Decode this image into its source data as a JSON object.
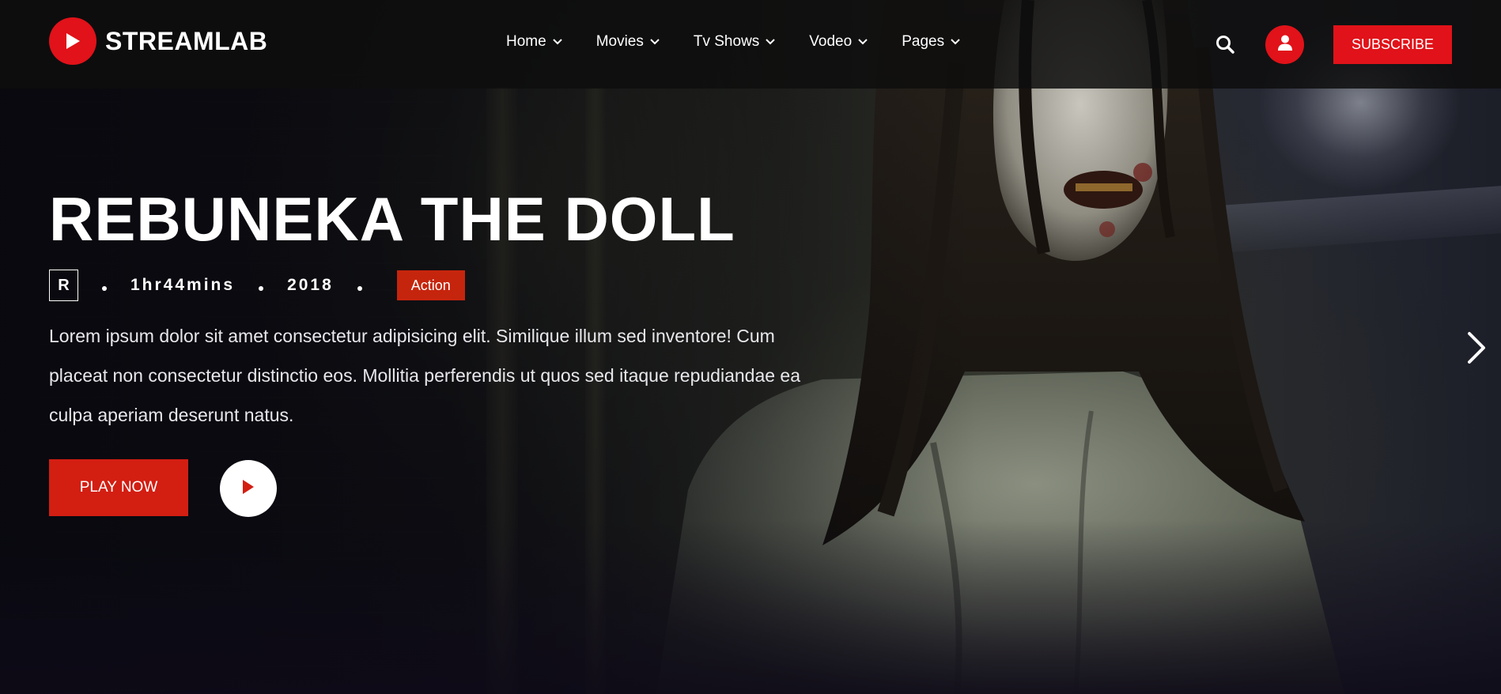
{
  "brand": {
    "name": "STREAMLAB",
    "logo_icon": "play-icon",
    "accent_color": "#e11219"
  },
  "nav": {
    "items": [
      {
        "label": "Home",
        "icon": "chevron-down-icon"
      },
      {
        "label": "Movies",
        "icon": "chevron-down-icon"
      },
      {
        "label": "Tv Shows",
        "icon": "chevron-down-icon"
      },
      {
        "label": "Vodeo",
        "icon": "chevron-down-icon"
      },
      {
        "label": "Pages",
        "icon": "chevron-down-icon"
      }
    ]
  },
  "header_actions": {
    "search_icon": "search-icon",
    "user_icon": "user-icon",
    "subscribe_label": "SUBSCRIBE"
  },
  "hero": {
    "title": "REBUNEKA THE DOLL",
    "rating": "R",
    "duration": "1hr44mins",
    "year": "2018",
    "genre": "Action",
    "genre_color": "#c6250d",
    "description": "Lorem ipsum dolor sit amet consectetur adipisicing elit. Similique illum sed inventore! Cum placeat non consectetur distinctio eos. Mollitia perferendis ut quos sed itaque repudiandae ea culpa aperiam deserunt natus.",
    "play_now_label": "PLAY NOW",
    "play_icon": "play-icon",
    "next_icon": "chevron-right-icon"
  }
}
